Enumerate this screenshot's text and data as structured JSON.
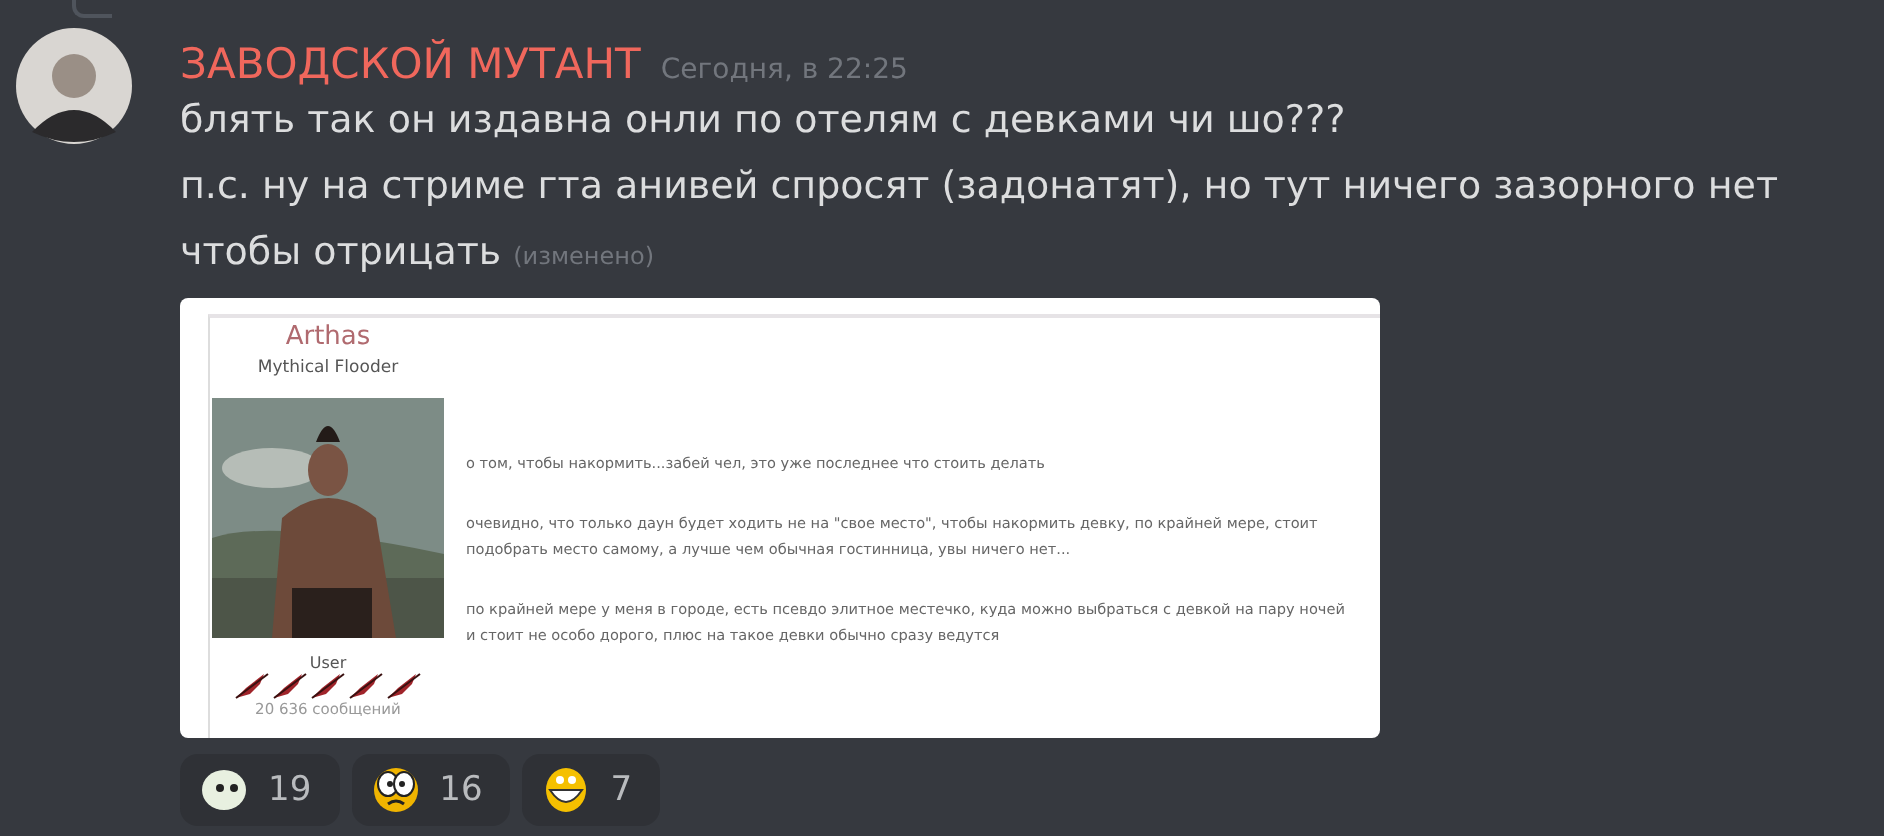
{
  "message": {
    "author": "ЗАВОДСКОЙ МУТАНТ",
    "timestamp": "Сегодня, в 22:25",
    "lines": [
      "блять так он издавна онли по отелям с девками чи шо???",
      "п.с. ну на стриме гта анивей спросят (задонатят), но тут ничего зазорного нет",
      "чтобы отрицать"
    ],
    "edited": "(изменено)"
  },
  "attachment": {
    "username": "Arthas",
    "user_title": "Mythical Flooder",
    "avatar": {
      "kind": "picture"
    },
    "role": "User",
    "post_count": "20 636 сообщений",
    "paragraphs": [
      [
        "о том, чтобы накормить...забей чел, это уже последнее что стоить делать"
      ],
      [
        "очевидно, что только даун будет ходить не на \"свое место\", чтобы накормить девку, по крайней мере, стоит",
        "подобрать место самому, а лучше чем обычная гостинница, увы ничего нет..."
      ],
      [
        "по крайней мере у меня в городе, есть псевдо элитное местечко, куда можно выбраться с девкой на пару ночей",
        "и стоит не особо дорого, плюс на такое девки обычно сразу ведутся"
      ]
    ]
  },
  "reactions": [
    {
      "kind": "blank",
      "count": "19"
    },
    {
      "kind": "shocked",
      "count": "16"
    },
    {
      "kind": "grin",
      "count": "7"
    }
  ]
}
